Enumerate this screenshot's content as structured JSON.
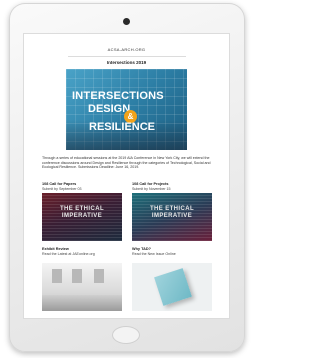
{
  "site": {
    "name": "ACSA-ARCH.ORG",
    "issue_title": "Intersections 2019"
  },
  "banner": {
    "line1": "INTERSECTIONS",
    "line2": "DESIGN",
    "amp": "&",
    "line3": "RESILIENCE"
  },
  "intro": "Through a series of educational sessions at the 2019 AIA Conference in New York City, we will extend the conference discussions around Design and Resilience through the categories of Technological, Social and Ecological Resilience. Submissions Deadline: June 16, 2019.",
  "cards": [
    {
      "title": "108 Call for Papers",
      "subtitle": "Submit by September 03",
      "thumb_text": "THE ETHICAL IMPERATIVE"
    },
    {
      "title": "108 Call for Projects",
      "subtitle": "Submit by November 15",
      "thumb_text": "THE ETHICAL IMPERATIVE"
    },
    {
      "title": "Exhibit Review",
      "subtitle": "Read the Latest at JAEonline.org"
    },
    {
      "title": "Why TAD?",
      "subtitle": "Read the New Issue Online"
    }
  ],
  "colors": {
    "banner_blue": "#2d7fa6",
    "amp_orange": "#f2a31b",
    "device_frame": "#ececec"
  }
}
